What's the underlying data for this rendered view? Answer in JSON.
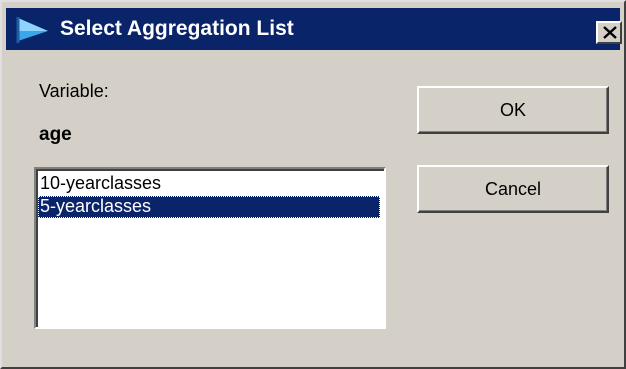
{
  "window": {
    "title": "Select Aggregation List",
    "title_icon": "flag-icon",
    "close_icon": "close-icon",
    "colors": {
      "titlebar": "#0a246a",
      "face": "#d4d0c8",
      "selection": "#0a246a"
    }
  },
  "variable": {
    "label": "Variable:",
    "value": "age"
  },
  "aggregation_list": {
    "items": [
      {
        "label": "10-yearclasses",
        "selected": false
      },
      {
        "label": "5-yearclasses",
        "selected": true
      }
    ]
  },
  "buttons": {
    "ok_label": "OK",
    "cancel_label": "Cancel"
  }
}
